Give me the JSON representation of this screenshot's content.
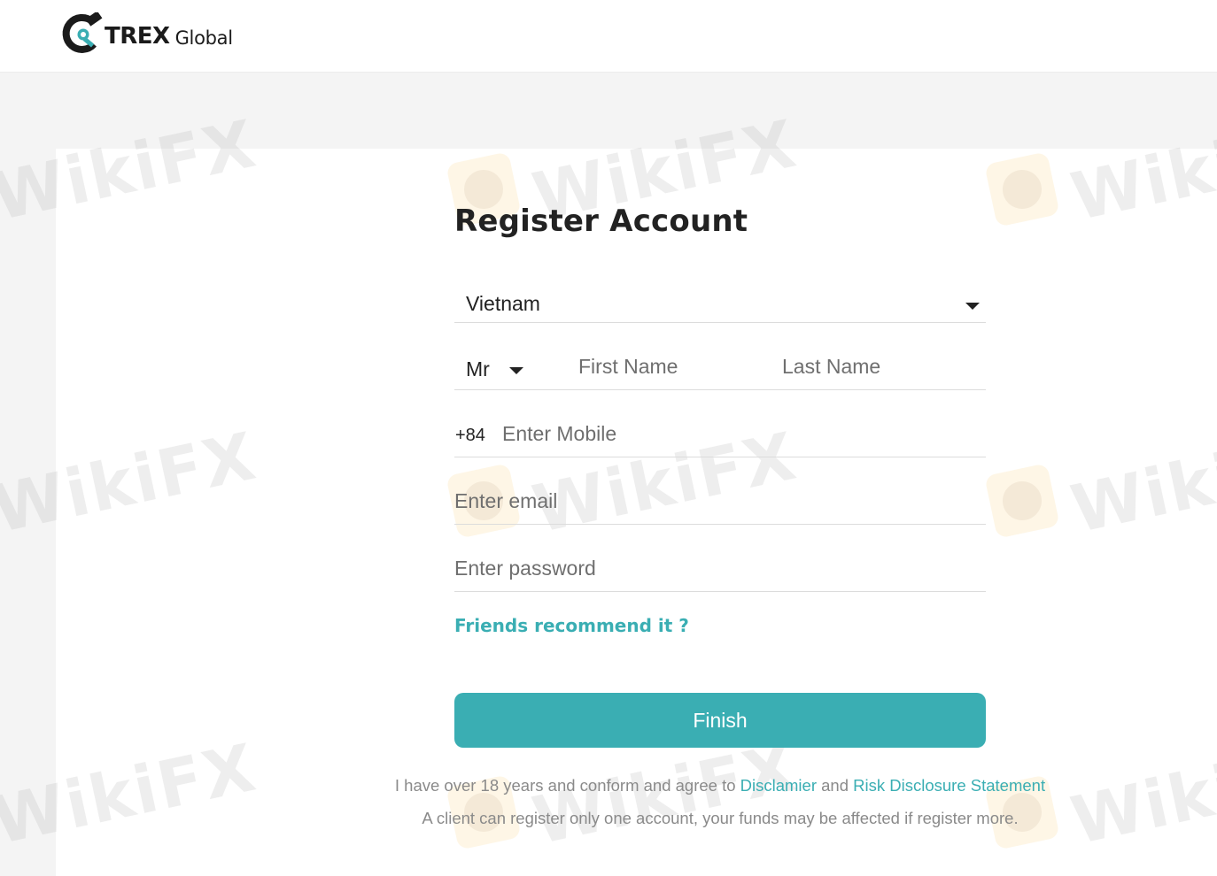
{
  "brand": {
    "name": "TREX",
    "suffix": "Global",
    "colors": {
      "accent": "#3aaeb3",
      "dark": "#1b1b1b"
    }
  },
  "form": {
    "title": "Register Account",
    "country": {
      "value": "Vietnam",
      "icon": "caret-down-icon"
    },
    "salutation": {
      "value": "Mr",
      "icon": "caret-down-icon"
    },
    "first_name": {
      "value": "",
      "placeholder": "First Name"
    },
    "last_name": {
      "value": "",
      "placeholder": "Last Name"
    },
    "mobile": {
      "prefix": "+84",
      "value": "",
      "placeholder": "Enter Mobile"
    },
    "email": {
      "value": "",
      "placeholder": "Enter email"
    },
    "password": {
      "value": "",
      "placeholder": "Enter password"
    },
    "friends_link": "Friends recommend it ?",
    "submit_label": "Finish"
  },
  "footer": {
    "agree_prefix": "I have over 18 years and conform and agree to",
    "disclaimer_link": "Disclamier",
    "and_word": "and",
    "risk_link": "Risk Disclosure Statement",
    "note": "A client can register only one account, your funds may be affected if register more."
  },
  "watermark": {
    "text": "WikiFX"
  }
}
